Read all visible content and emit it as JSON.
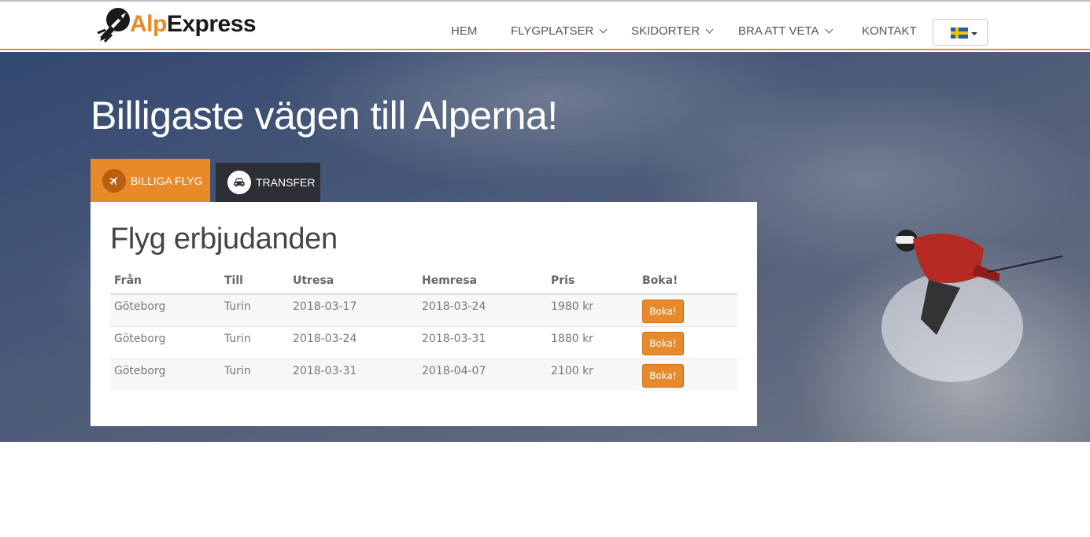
{
  "brand": {
    "name_accent": "Alp",
    "name_rest": "Express",
    "accent_color": "#e8892a"
  },
  "nav": {
    "items": [
      {
        "label": "HEM",
        "dropdown": false
      },
      {
        "label": "FLYGPLATSER",
        "dropdown": true
      },
      {
        "label": "SKIDORTER",
        "dropdown": true
      },
      {
        "label": "BRA ATT VETA",
        "dropdown": true
      },
      {
        "label": "KONTAKT",
        "dropdown": false
      }
    ],
    "language_icon": "sweden-flag-icon"
  },
  "hero": {
    "title": "Billigaste vägen till Alperna!"
  },
  "tabs": [
    {
      "label": "BILLIGA FLYG",
      "icon": "airplane-icon",
      "active": true
    },
    {
      "label": "TRANSFER",
      "icon": "car-icon",
      "active": false
    }
  ],
  "panel": {
    "title": "Flyg erbjudanden",
    "columns": [
      "Från",
      "Till",
      "Utresa",
      "Hemresa",
      "Pris",
      "Boka!"
    ],
    "rows": [
      {
        "from": "Göteborg",
        "to": "Turin",
        "out": "2018-03-17",
        "home": "2018-03-24",
        "price": "1980 kr",
        "book": "Boka!"
      },
      {
        "from": "Göteborg",
        "to": "Turin",
        "out": "2018-03-24",
        "home": "2018-03-31",
        "price": "1880 kr",
        "book": "Boka!"
      },
      {
        "from": "Göteborg",
        "to": "Turin",
        "out": "2018-03-31",
        "home": "2018-04-07",
        "price": "2100 kr",
        "book": "Boka!"
      }
    ]
  }
}
